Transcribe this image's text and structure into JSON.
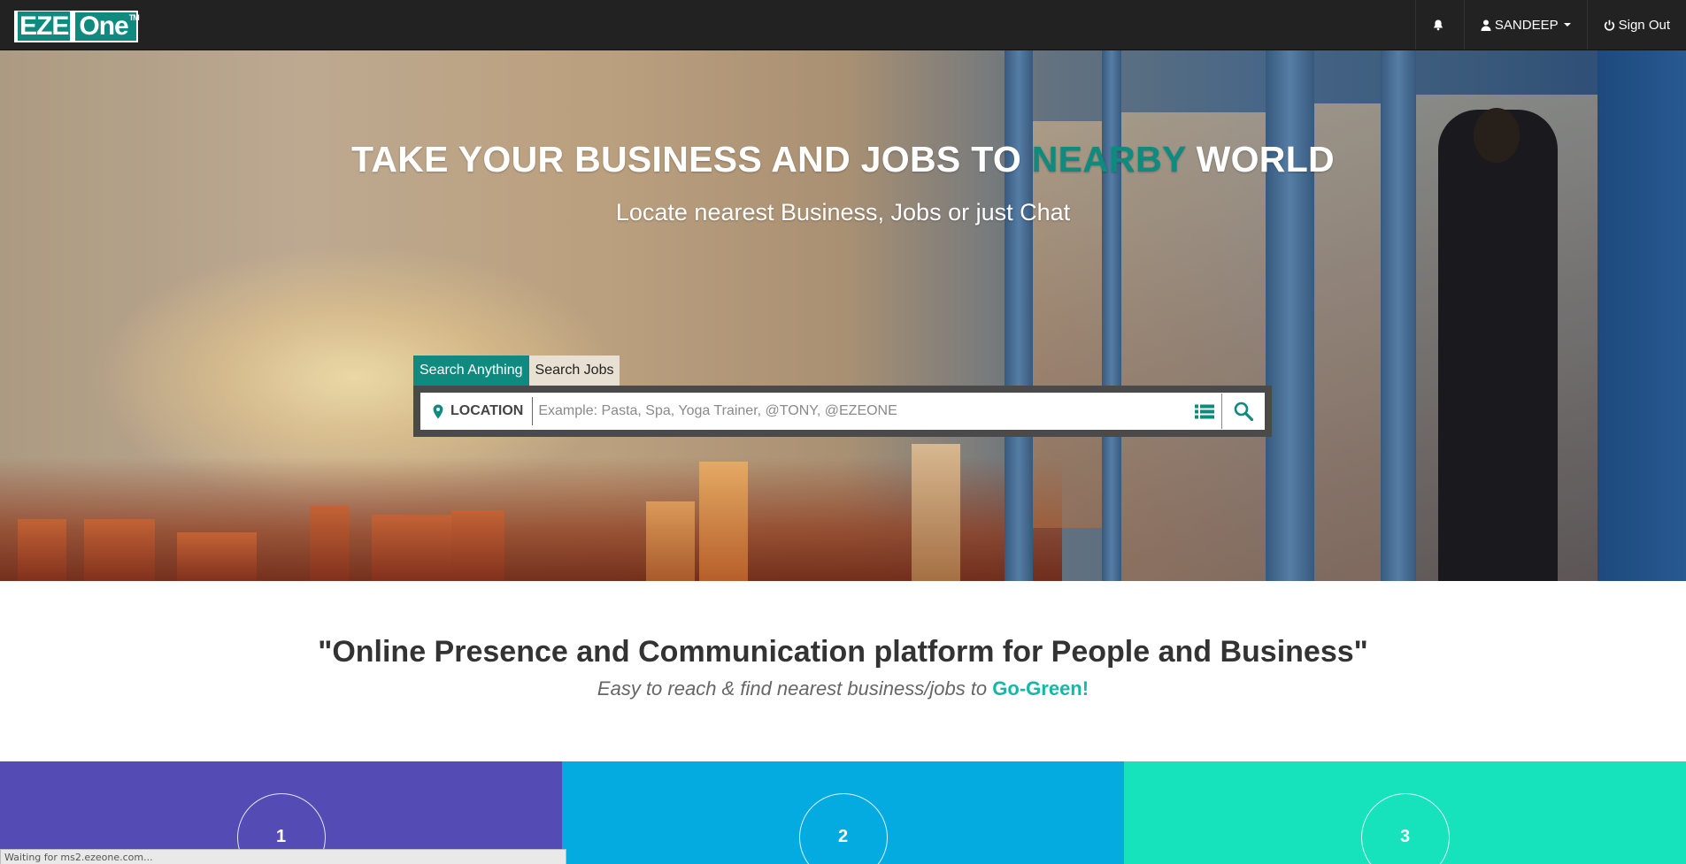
{
  "navbar": {
    "logo_eze": "EZE",
    "logo_one": "One",
    "logo_tm": "TM",
    "notifications_icon": "bell-icon",
    "user_label": "SANDEEP",
    "signout_label": "Sign Out"
  },
  "hero": {
    "title_pre": "TAKE YOUR BUSINESS AND JOBS TO ",
    "title_accent": "NEARBY",
    "title_post": " WORLD",
    "subtitle": "Locate nearest Business, Jobs or just Chat"
  },
  "search": {
    "tabs": [
      {
        "label": "Search Anything",
        "active": true
      },
      {
        "label": "Search Jobs",
        "active": false
      }
    ],
    "location_label": "LOCATION",
    "placeholder": "Example: Pasta, Spa, Yoga Trainer, @TONY, @EZEONE",
    "value": ""
  },
  "tagline": {
    "title": "\"Online Presence and Communication platform for People and Business\"",
    "sub_pre": "Easy to reach & find nearest business/jobs to ",
    "sub_accent": "Go-Green!"
  },
  "features": [
    {
      "number": "1",
      "color": "#554bb5"
    },
    {
      "number": "2",
      "color": "#04abe0"
    },
    {
      "number": "3",
      "color": "#16e2bb"
    }
  ],
  "colors": {
    "brand": "#0f8a7f",
    "navbar": "#222222",
    "accent_green": "#14b8a6"
  },
  "status": {
    "text": "Waiting for ms2.ezeone.com..."
  }
}
